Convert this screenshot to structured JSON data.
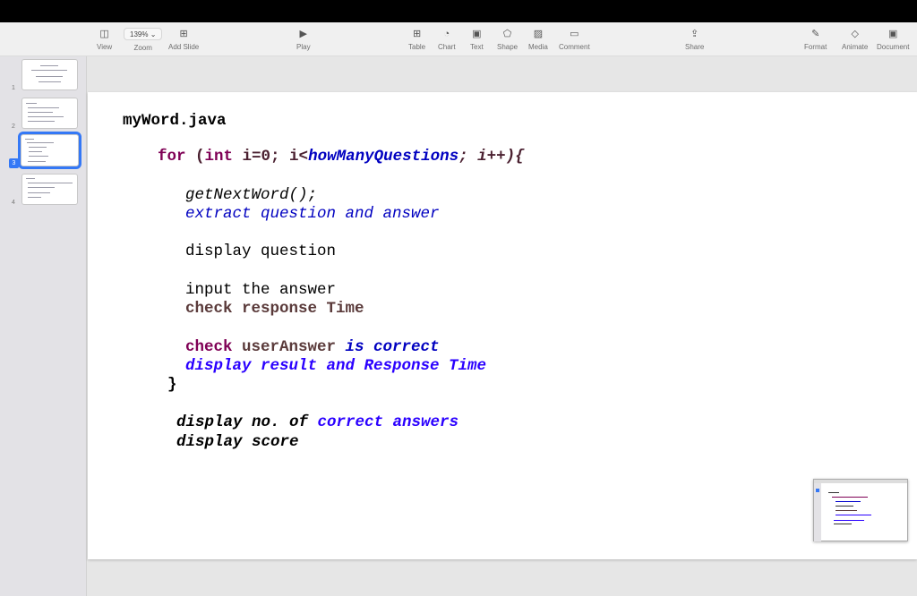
{
  "toolbar": {
    "view": "View",
    "zoom_value": "139%",
    "zoom": "Zoom",
    "add_slide": "Add Slide",
    "play": "Play",
    "table": "Table",
    "chart": "Chart",
    "text": "Text",
    "shape": "Shape",
    "media": "Media",
    "comment": "Comment",
    "share": "Share",
    "format": "Format",
    "animate": "Animate",
    "document": "Document"
  },
  "sidebar": {
    "slides": [
      {
        "number": "1"
      },
      {
        "number": "2"
      },
      {
        "number": "3",
        "selected": true
      },
      {
        "number": "4"
      }
    ]
  },
  "slide": {
    "title": "myWord.java",
    "for_kw": "for",
    "paren": " (",
    "int_kw": "int",
    "init": " i=0; i<",
    "limit": "howManyQuestions",
    "incr": "; i++){",
    "l1": "getNextWord();",
    "l2": "extract question and answer",
    "l3": "display question",
    "l4": "input the answer",
    "l5": "check response Time",
    "l6a": "check",
    "l6b": " userAnswer ",
    "l6c": "is correct",
    "l7": "display result and Response Time",
    "brace": "}",
    "l8a": "display no. of ",
    "l8b": "correct answers",
    "l9": "display score"
  },
  "colors": {
    "keyword": "#7f0055",
    "field": "#0000c0",
    "blue": "#2a00ff",
    "brown": "#5a3a3a",
    "selection": "#3478f6"
  }
}
